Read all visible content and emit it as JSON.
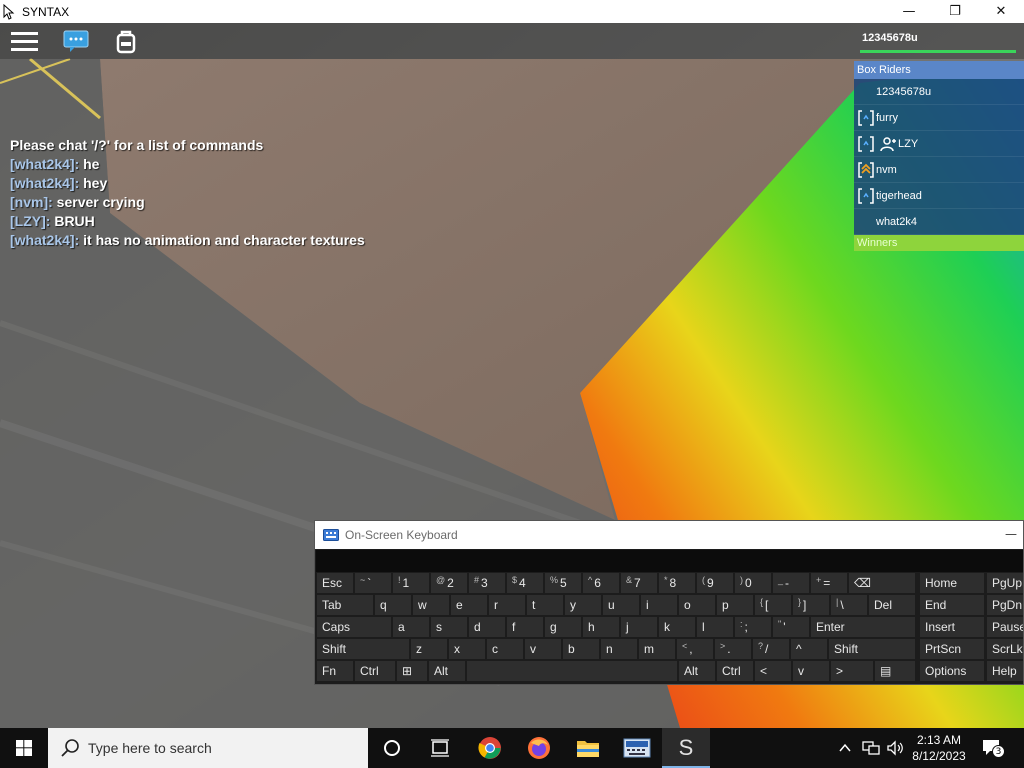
{
  "window": {
    "title": "SYNTAX",
    "minimize_glyph": "—",
    "restore_glyph": "❐",
    "close_glyph": "✕"
  },
  "game": {
    "player_name": "12345678u",
    "chat": [
      {
        "speaker": "",
        "text": "Please chat '/?' for a list of commands"
      },
      {
        "speaker": "[what2k4]:",
        "text": " he"
      },
      {
        "speaker": "[what2k4]:",
        "text": " hey"
      },
      {
        "speaker": "[nvm]:",
        "text": " server crying"
      },
      {
        "speaker": "[LZY]:",
        "text": " BRUH"
      },
      {
        "speaker": "[what2k4]:",
        "text": " it has no animation and character textures"
      }
    ],
    "leaderboard": {
      "team1": "Box Riders",
      "players": [
        {
          "name": "12345678u",
          "badge": "none"
        },
        {
          "name": "furry",
          "badge": "bracket-icon"
        },
        {
          "name": "LZY",
          "badge": "friend-icon"
        },
        {
          "name": "nvm",
          "badge": "rank-chevron-icon"
        },
        {
          "name": "tigerhead",
          "badge": "bracket-icon"
        },
        {
          "name": "what2k4",
          "badge": "none"
        }
      ],
      "team2": "Winners"
    },
    "colors": {
      "team1": "#5a86c8",
      "team2": "#8ed43c",
      "chat_name": "#a9c6e8",
      "health": "#3ad45a"
    }
  },
  "osk": {
    "title": "On-Screen Keyboard",
    "minimize_glyph": "—",
    "row1": [
      {
        "main": "Esc"
      },
      {
        "sub": "~",
        "main": "`"
      },
      {
        "sub": "!",
        "main": "1"
      },
      {
        "sub": "@",
        "main": "2"
      },
      {
        "sub": "#",
        "main": "3"
      },
      {
        "sub": "$",
        "main": "4"
      },
      {
        "sub": "%",
        "main": "5"
      },
      {
        "sub": "^",
        "main": "6"
      },
      {
        "sub": "&",
        "main": "7"
      },
      {
        "sub": "*",
        "main": "8"
      },
      {
        "sub": "(",
        "main": "9"
      },
      {
        "sub": ")",
        "main": "0"
      },
      {
        "sub": "_",
        "main": "-"
      },
      {
        "sub": "+",
        "main": "="
      },
      {
        "main": "⌫"
      },
      {
        "main": "Home"
      },
      {
        "main": "PgUp"
      }
    ],
    "row2": [
      {
        "main": "Tab"
      },
      {
        "main": "q"
      },
      {
        "main": "w"
      },
      {
        "main": "e"
      },
      {
        "main": "r"
      },
      {
        "main": "t"
      },
      {
        "main": "y"
      },
      {
        "main": "u"
      },
      {
        "main": "i"
      },
      {
        "main": "o"
      },
      {
        "main": "p"
      },
      {
        "sub": "{",
        "main": "["
      },
      {
        "sub": "}",
        "main": "]"
      },
      {
        "sub": "|",
        "main": "\\"
      },
      {
        "main": "Del"
      },
      {
        "main": "End"
      },
      {
        "main": "PgDn"
      }
    ],
    "row3": [
      {
        "main": "Caps"
      },
      {
        "main": "a"
      },
      {
        "main": "s"
      },
      {
        "main": "d"
      },
      {
        "main": "f"
      },
      {
        "main": "g"
      },
      {
        "main": "h"
      },
      {
        "main": "j"
      },
      {
        "main": "k"
      },
      {
        "main": "l"
      },
      {
        "sub": ":",
        "main": ";"
      },
      {
        "sub": "\"",
        "main": "'"
      },
      {
        "main": "Enter"
      },
      {
        "main": "Insert"
      },
      {
        "main": "Pause"
      }
    ],
    "row4": [
      {
        "main": "Shift"
      },
      {
        "main": "z"
      },
      {
        "main": "x"
      },
      {
        "main": "c"
      },
      {
        "main": "v"
      },
      {
        "main": "b"
      },
      {
        "main": "n"
      },
      {
        "main": "m"
      },
      {
        "sub": "<",
        "main": ","
      },
      {
        "sub": ">",
        "main": "."
      },
      {
        "sub": "?",
        "main": "/"
      },
      {
        "main": "^"
      },
      {
        "main": "Shift"
      },
      {
        "main": "PrtScn"
      },
      {
        "main": "ScrLk"
      }
    ],
    "row5": [
      {
        "main": "Fn"
      },
      {
        "main": "Ctrl"
      },
      {
        "main": "⊞"
      },
      {
        "main": "Alt"
      },
      {
        "main": ""
      },
      {
        "main": "Alt"
      },
      {
        "main": "Ctrl"
      },
      {
        "main": "<"
      },
      {
        "main": "v"
      },
      {
        "main": ">"
      },
      {
        "main": "▤"
      },
      {
        "main": "Options"
      },
      {
        "main": "Help"
      }
    ]
  },
  "taskbar": {
    "search_placeholder": "Type here to search",
    "time": "2:13 AM",
    "date": "8/12/2023",
    "notification_count": "3"
  }
}
